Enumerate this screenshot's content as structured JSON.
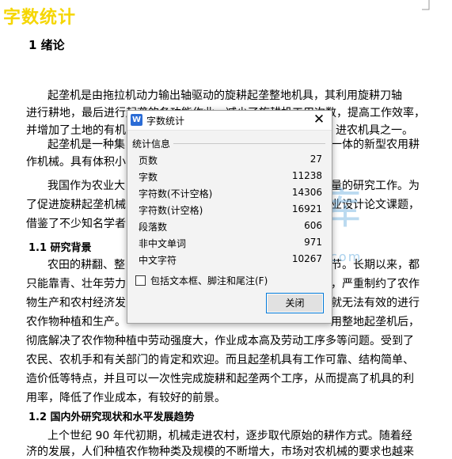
{
  "overlay": {
    "title": "字数统计"
  },
  "document": {
    "chapter_heading": "1   绪论",
    "lines": [
      "起垄机是由拖拉机动力输出轴驱动的旋耕起垄整地机具，其利用旋耕刀轴",
      "进行耕地，最后进行起垄的各功能作业，减少了旋耕机工用次数，提高工作效率，",
      "并增加了土地的有机",
      "进农机具之一。",
      "起垄机是一种集",
      "一体的新型农用耕",
      "作机械。具有体积小",
      "我国作为农业大",
      "量的研究工作。为",
      "了促进旋耕起垄机械",
      "业设计论文课题，",
      "借鉴了不少知名学者"
    ],
    "section_1_1": "1.1    研究背景",
    "lines2": [
      "农田的耕翻、整",
      "节。长期以来，都",
      "只能靠青、壮年劳力",
      "，严重制约了农作",
      "物生产和农村经济发",
      "就无法有效的进行",
      "农作物种植和生产。",
      "用整地起垄机后，",
      "彻底解决了农作物种植中劳动强度大，作业成本高及劳动工序多等问题。受到了",
      "农民、农机手和有关部门的肯定和欢迎。而且起垄机具有工作可靠、结构简单、",
      "造价低等特点，并且可以一次性完成旋耕和起垄两个工序，从而提高了机具的利",
      "用率，降低了作业成本，有较好的前景。"
    ],
    "section_1_2": "1.2    国内外研究现状和水平发展趋势",
    "lines3": [
      "上个世纪 90 年代初期，机械走进农村，逐步取代原始的耕作方式。随着经",
      "济的发展，人们种植农作物种类及规模的不断增大，市场对农机械的要求也越来"
    ]
  },
  "dialog": {
    "title": "字数统计",
    "icon": "wps-w-icon",
    "group_label": "统计信息",
    "stats": [
      {
        "label": "页数",
        "value": "27"
      },
      {
        "label": "字数",
        "value": "11238"
      },
      {
        "label": "字符数(不计空格)",
        "value": "14306"
      },
      {
        "label": "字符数(计空格)",
        "value": "16921"
      },
      {
        "label": "段落数",
        "value": "606"
      },
      {
        "label": "非中文单词",
        "value": "971"
      },
      {
        "label": "中文字符",
        "value": "10267"
      }
    ],
    "checkbox_label": "包括文本框、脚注和尾注(F)",
    "checkbox_checked": false,
    "close_button": "关闭",
    "close_glyph": "✕"
  },
  "watermark": {
    "text": "文库",
    "url_text": "www.renrendoc.com"
  },
  "colors": {
    "overlay_title": "#f5d600",
    "button_border": "#0078d7",
    "watermark": "#6aaee0"
  }
}
